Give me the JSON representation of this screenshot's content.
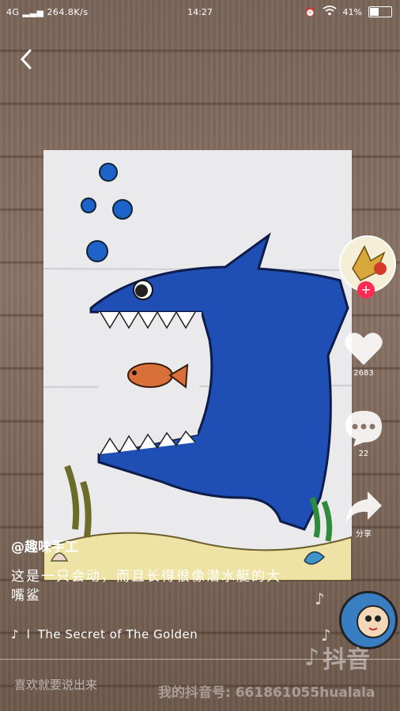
{
  "status_bar": {
    "network": "4G",
    "speed": "264.8K/s",
    "time": "14:27",
    "battery": "41%",
    "battery_level": 0.41
  },
  "side_actions": {
    "likes_count": "2683",
    "comments_count": "22",
    "share_label": "分享"
  },
  "author": "@趣味手工",
  "caption": "这是一只会动，而且长得很像潜水艇的大嘴鲨",
  "music": "The Secret of The Golden",
  "music_prefix": "l",
  "comment_placeholder": "喜欢就要说出来",
  "watermark_text": "抖音",
  "douyin_id": "我的抖音号: 661861055hualala",
  "colors": {
    "accent": "#fe2c55",
    "shark": "#1f4fb5"
  }
}
